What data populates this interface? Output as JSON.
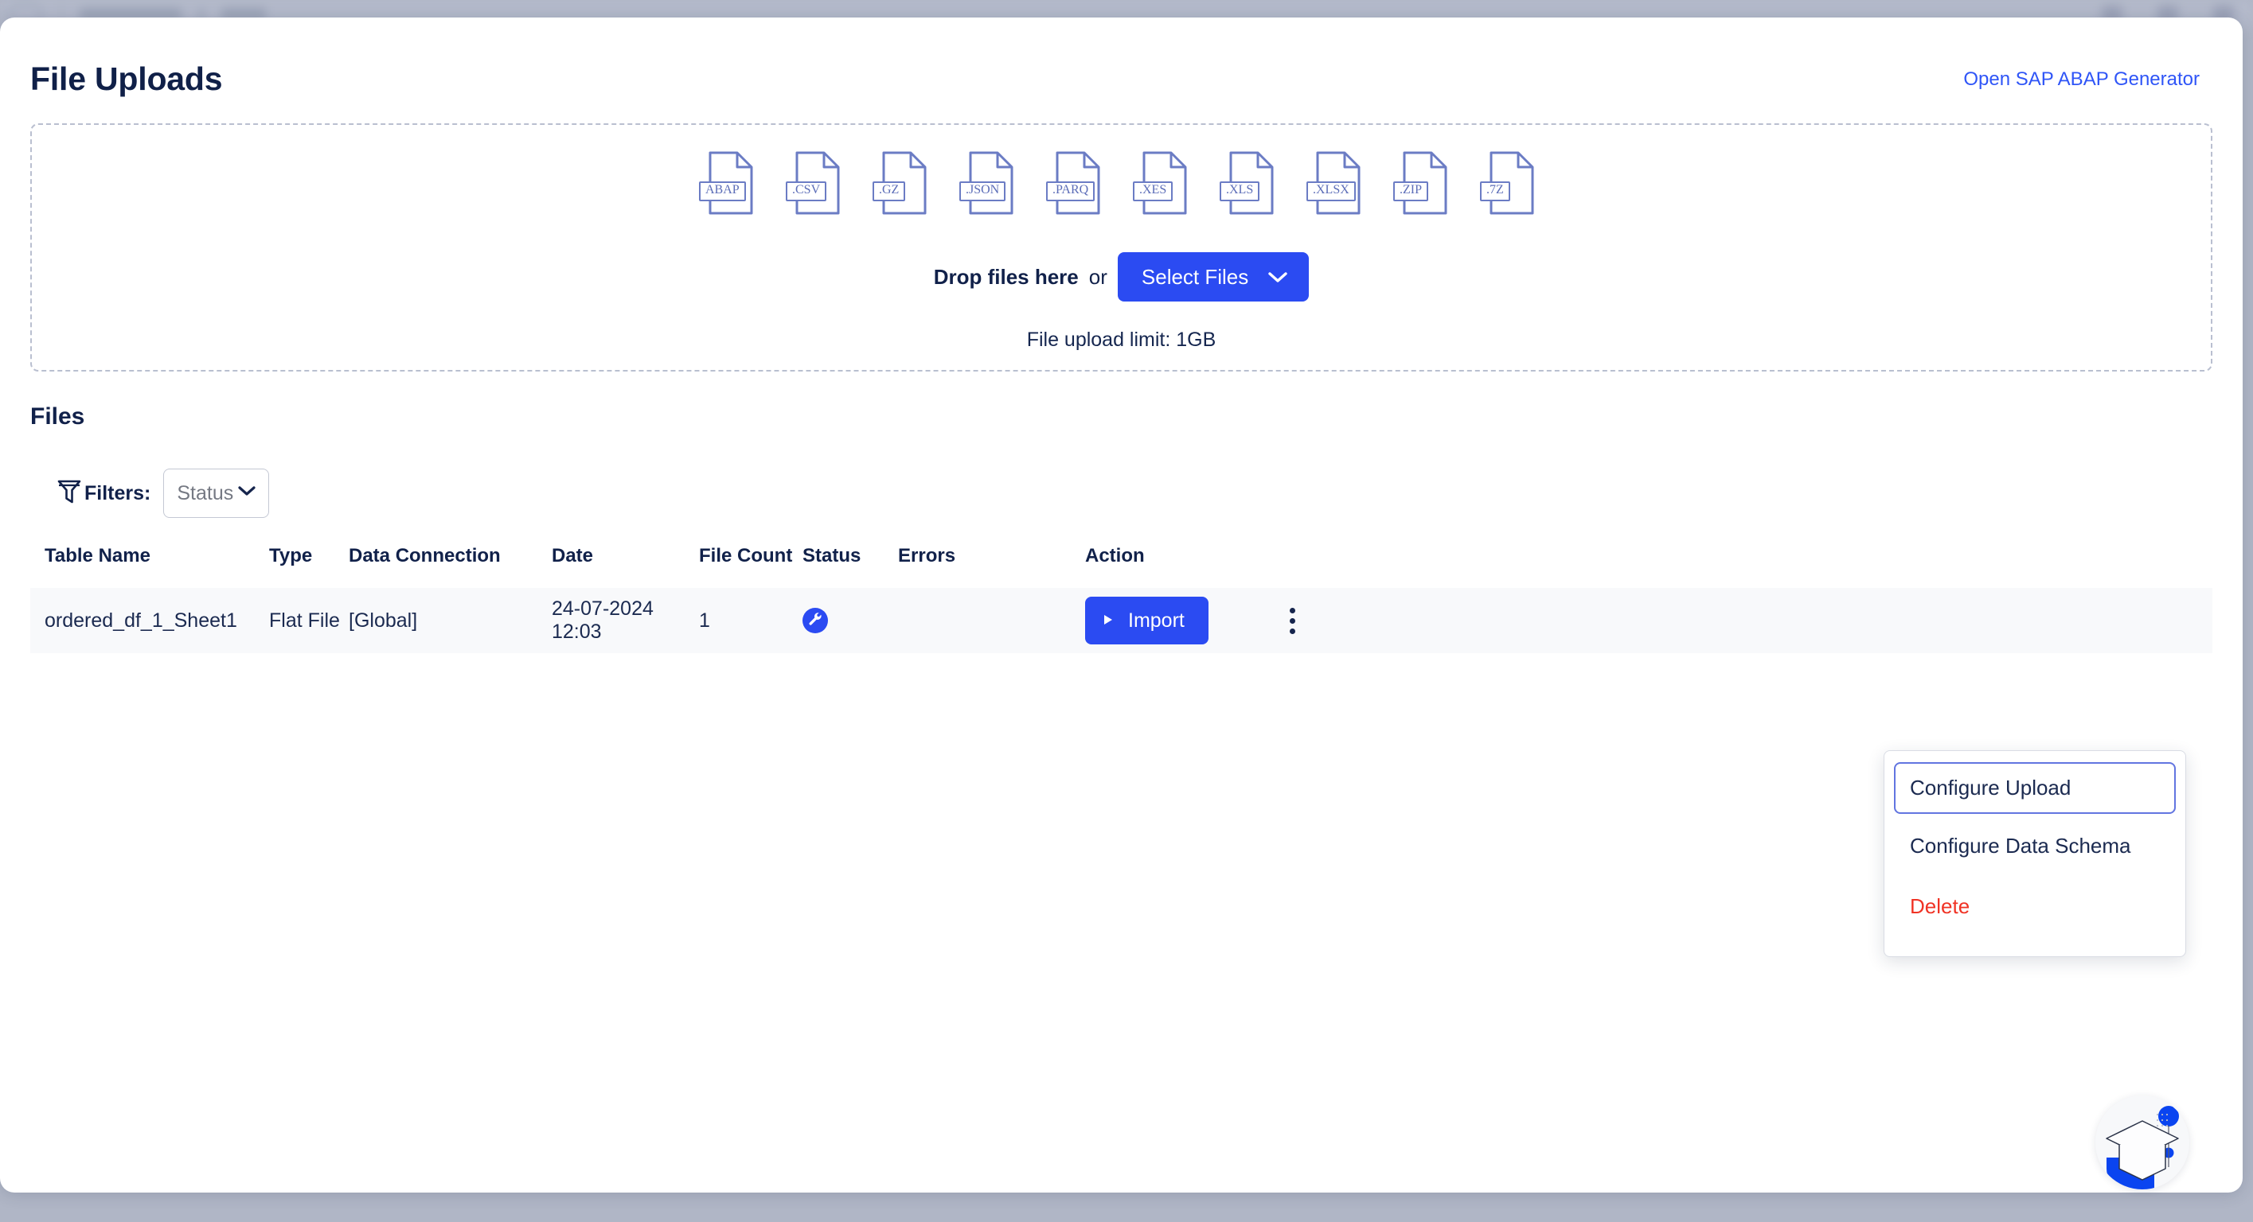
{
  "background": {
    "breadcrumb_blurred": true
  },
  "header": {
    "title": "File Uploads",
    "action_link": "Open SAP ABAP Generator"
  },
  "dropzone": {
    "file_types": [
      {
        "label": "ABAP",
        "icon": "file-abap-icon"
      },
      {
        "label": ".CSV",
        "icon": "file-csv-icon"
      },
      {
        "label": ".GZ",
        "icon": "file-gz-icon"
      },
      {
        "label": ".JSON",
        "icon": "file-json-icon"
      },
      {
        "label": ".PARQ",
        "icon": "file-parq-icon"
      },
      {
        "label": ".XES",
        "icon": "file-xes-icon"
      },
      {
        "label": ".XLS",
        "icon": "file-xls-icon"
      },
      {
        "label": ".XLSX",
        "icon": "file-xlsx-icon"
      },
      {
        "label": ".ZIP",
        "icon": "file-zip-icon"
      },
      {
        "label": ".7Z",
        "icon": "file-7z-icon"
      }
    ],
    "drop_strong": "Drop files here",
    "drop_or": "or",
    "select_button": "Select Files",
    "limit_text": "File upload limit: 1GB"
  },
  "files_section": {
    "heading": "Files",
    "filters_label": "Filters:",
    "status_filter_placeholder": "Status",
    "status_filter_value": "",
    "columns": [
      "Table Name",
      "Type",
      "Data Connection",
      "Date",
      "File Count",
      "Status",
      "Errors",
      "Action"
    ],
    "rows": [
      {
        "table_name": "ordered_df_1_Sheet1",
        "type": "Flat File",
        "data_connection": "[Global]",
        "date": "24-07-2024 12:03",
        "file_count": "1",
        "status_icon": "wrench-icon",
        "errors": "",
        "import_label": "Import"
      }
    ]
  },
  "context_menu": {
    "items": [
      {
        "label": "Configure Upload",
        "focused": true,
        "danger": false
      },
      {
        "label": "Configure Data Schema",
        "focused": false,
        "danger": false
      },
      {
        "label": "Delete",
        "focused": false,
        "danger": true
      }
    ]
  },
  "help_widget": {
    "icon": "graduation-cap-icon"
  },
  "colors": {
    "accent_blue": "#2b4bf2",
    "link_blue": "#2f55f7",
    "title_navy": "#102048",
    "danger_red": "#f03325",
    "file_icon_blue": "#6b7cc4",
    "row_bg": "#f8f9fb",
    "page_backdrop": "#b0b6c6"
  }
}
